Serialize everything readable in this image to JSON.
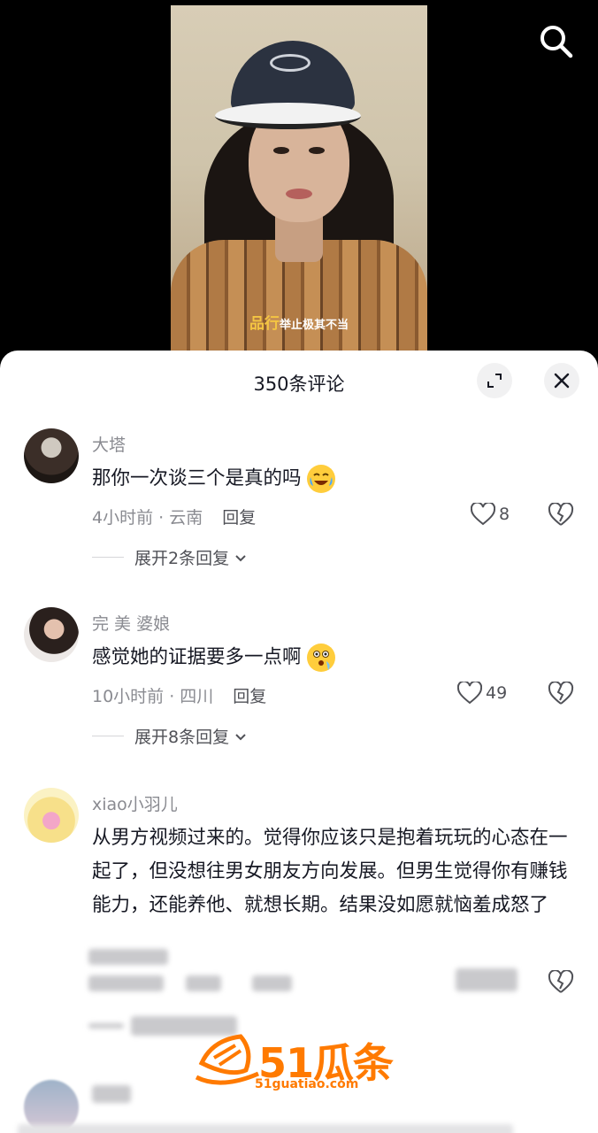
{
  "video": {
    "subtitle_highlight": "品行",
    "subtitle_rest": "举止极其不当"
  },
  "header": {
    "comment_count_title": "350条评论"
  },
  "comments": [
    {
      "username": "大塔",
      "text": "那你一次谈三个是真的吗",
      "emoji": "crying-laughing-emoji",
      "time_location": "4小时前 · 云南",
      "reply_label": "回复",
      "likes": "8",
      "expand_replies": "展开2条回复"
    },
    {
      "username": "完 美 婆娘",
      "text": "感觉她的证据要多一点啊",
      "emoji": "thinking-emoji",
      "time_location": "10小时前 · 四川",
      "reply_label": "回复",
      "likes": "49",
      "expand_replies": "展开8条回复"
    },
    {
      "username": "xiao小羽儿",
      "text": "从男方视频过来的。觉得你应该只是抱着玩玩的心态在一起了，但没想往男女朋友方向发展。但男生觉得你有赚钱能力，还能养他、就想长期。结果没如愿就恼羞成怒了"
    }
  ],
  "watermark": {
    "brand": "51瓜条",
    "url": "51guatiao.com"
  },
  "colors": {
    "accent_orange": "#ff7a00",
    "subtitle_yellow": "#f4c542",
    "text_primary": "#161823",
    "text_secondary": "#8a8b91"
  }
}
